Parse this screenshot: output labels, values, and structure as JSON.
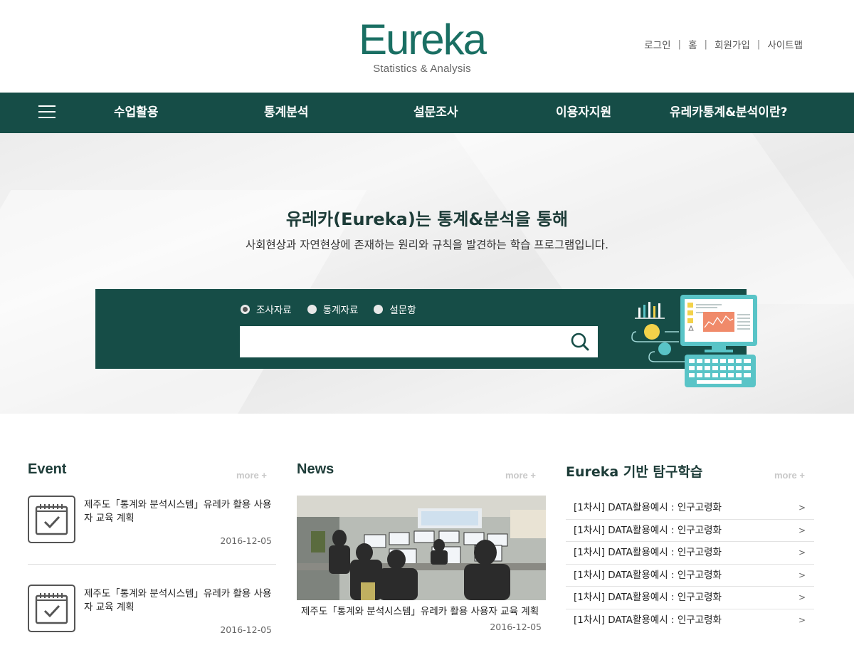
{
  "header": {
    "logo_main": "Eureka",
    "logo_sub": "Statistics & Analysis",
    "util_links": [
      "로그인",
      "홈",
      "회원가입",
      "사이트맵"
    ],
    "util_separator": "|"
  },
  "nav": {
    "items": [
      "수업활용",
      "통계분석",
      "설문조사",
      "이용자지원",
      "유레카통계&분석이란?"
    ]
  },
  "hero": {
    "title": "유레카(Eureka)는 통계&분석을 통해",
    "subtitle": "사회현상과 자연현상에 존재하는 원리와 규칙을 발견하는 학습 프로그램입니다.",
    "search": {
      "options": [
        "조사자료",
        "통계자료",
        "설문항"
      ],
      "selected": "조사자료",
      "value": "",
      "placeholder": ""
    }
  },
  "event": {
    "title": "Event",
    "more": "more +",
    "items": [
      {
        "text": "제주도「통계와 분석시스템」유레카 활용 사용자 교육 계획",
        "date": "2016-12-05"
      },
      {
        "text": "제주도「통계와 분석시스템」유레카 활용 사용자 교육 계획",
        "date": "2016-12-05"
      }
    ]
  },
  "news": {
    "title": "News",
    "more": "more +",
    "item": {
      "text": "제주도「통계와 분석시스템」유레카 활용 사용자 교육 계획",
      "date": "2016-12-05"
    }
  },
  "study": {
    "title": "Eureka 기반 탐구학습",
    "more": "more +",
    "items": [
      "[1차시] DATA활용예시 : 인구고령화",
      "[1차시] DATA활용예시 : 인구고령화",
      "[1차시] DATA활용예시 : 인구고령화",
      "[1차시] DATA활용예시 : 인구고령화",
      "[1차시] DATA활용예시 : 인구고령화",
      "[1차시] DATA활용예시 : 인구고령화"
    ],
    "chevron": ">"
  },
  "colors": {
    "brand_green": "#164d47",
    "logo_green": "#1a6f63",
    "accent_teal": "#59c4c7",
    "accent_yellow": "#f3d24a"
  },
  "icons": [
    "menu-icon",
    "search-icon",
    "calendar-check-icon",
    "chevron-right-icon"
  ]
}
